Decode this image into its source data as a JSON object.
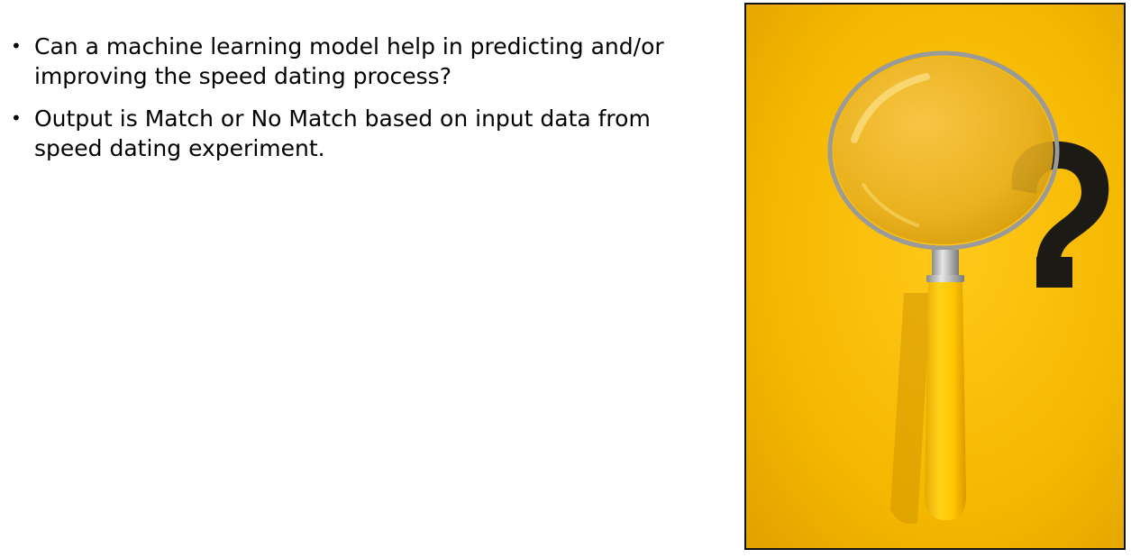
{
  "bullets": [
    {
      "text": "Can a machine learning model help in predicting and/or improving the speed dating process?"
    },
    {
      "text": "Output is Match or No Match based on input data from speed dating experiment."
    }
  ],
  "bullet_symbol": "•",
  "image": {
    "subject": "magnifying-glass-with-question-mark",
    "question_mark": "?",
    "colors": {
      "background": "#f2b400",
      "handle": "#ffc400",
      "question_mark": "#1c1a14"
    }
  }
}
